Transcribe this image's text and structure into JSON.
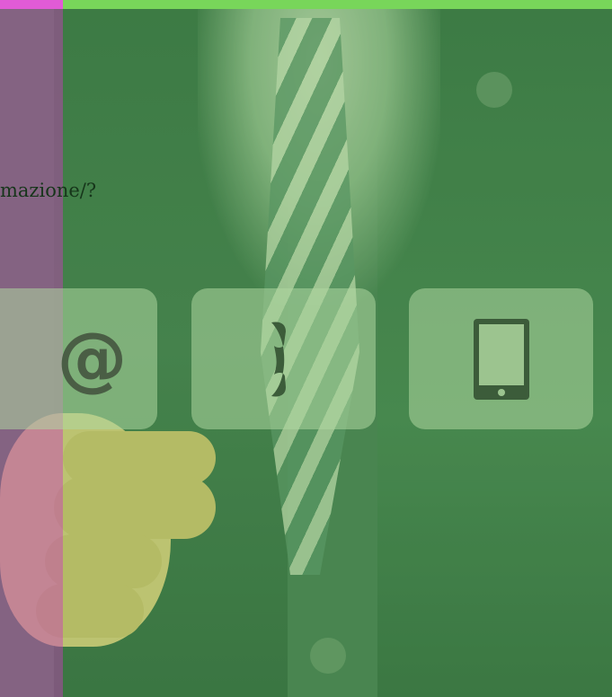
{
  "url_fragment": "mazione/?",
  "contacts": [
    {
      "type": "email",
      "icon": "at-icon"
    },
    {
      "type": "phone",
      "icon": "phone-handset-icon"
    },
    {
      "type": "mobile",
      "icon": "tablet-icon"
    }
  ],
  "colors": {
    "top_bar": "#78d65a",
    "left_strip": "#e15bd6",
    "card_bg": "#afd7a0",
    "icon": "#3c5c3a"
  }
}
